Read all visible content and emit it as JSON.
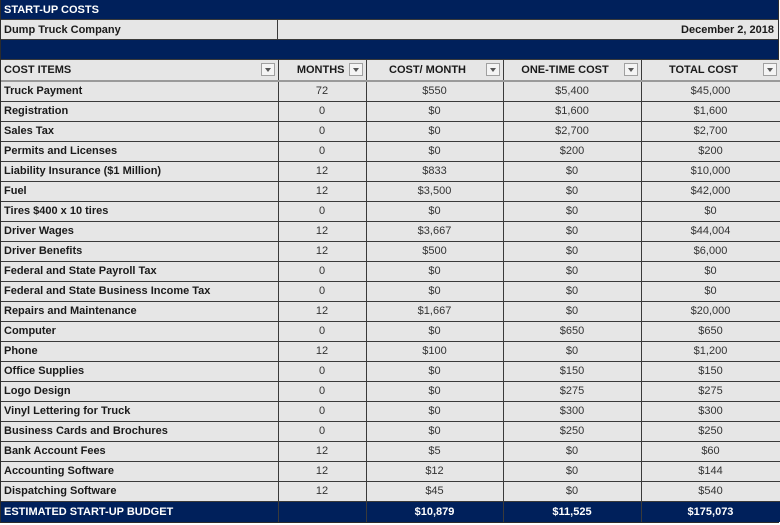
{
  "title": "START-UP COSTS",
  "company": "Dump Truck Company",
  "date": "December 2, 2018",
  "colors": {
    "header_band": "#00205b",
    "cell_bg": "#e6e6e6"
  },
  "columns": [
    {
      "label": "COST ITEMS",
      "filter_icon": "dropdown-filter-icon"
    },
    {
      "label": "MONTHS",
      "filter_icon": "dropdown-filter-icon"
    },
    {
      "label": "COST/ MONTH",
      "filter_icon": "dropdown-filter-icon"
    },
    {
      "label": "ONE-TIME COST",
      "filter_icon": "dropdown-filter-icon"
    },
    {
      "label": "TOTAL COST",
      "filter_icon": "dropdown-filter-icon"
    }
  ],
  "rows": [
    {
      "item": "Truck Payment",
      "months": "72",
      "cost_month": "$550",
      "one_time": "$5,400",
      "total": "$45,000"
    },
    {
      "item": "Registration",
      "months": "0",
      "cost_month": "$0",
      "one_time": "$1,600",
      "total": "$1,600"
    },
    {
      "item": "Sales Tax",
      "months": "0",
      "cost_month": "$0",
      "one_time": "$2,700",
      "total": "$2,700"
    },
    {
      "item": "Permits and Licenses",
      "months": "0",
      "cost_month": "$0",
      "one_time": "$200",
      "total": "$200"
    },
    {
      "item": "Liability Insurance ($1 Million)",
      "months": "12",
      "cost_month": "$833",
      "one_time": "$0",
      "total": "$10,000"
    },
    {
      "item": "Fuel",
      "months": "12",
      "cost_month": "$3,500",
      "one_time": "$0",
      "total": "$42,000"
    },
    {
      "item": "Tires $400 x 10 tires",
      "months": "0",
      "cost_month": "$0",
      "one_time": "$0",
      "total": "$0"
    },
    {
      "item": "Driver Wages",
      "months": "12",
      "cost_month": "$3,667",
      "one_time": "$0",
      "total": "$44,004"
    },
    {
      "item": "Driver Benefits",
      "months": "12",
      "cost_month": "$500",
      "one_time": "$0",
      "total": "$6,000"
    },
    {
      "item": "Federal and State Payroll Tax",
      "months": "0",
      "cost_month": "$0",
      "one_time": "$0",
      "total": "$0"
    },
    {
      "item": "Federal and State Business Income Tax",
      "months": "0",
      "cost_month": "$0",
      "one_time": "$0",
      "total": "$0"
    },
    {
      "item": "Repairs and Maintenance",
      "months": "12",
      "cost_month": "$1,667",
      "one_time": "$0",
      "total": "$20,000"
    },
    {
      "item": "Computer",
      "months": "0",
      "cost_month": "$0",
      "one_time": "$650",
      "total": "$650"
    },
    {
      "item": "Phone",
      "months": "12",
      "cost_month": "$100",
      "one_time": "$0",
      "total": "$1,200"
    },
    {
      "item": "Office Supplies",
      "months": "0",
      "cost_month": "$0",
      "one_time": "$150",
      "total": "$150"
    },
    {
      "item": "Logo Design",
      "months": "0",
      "cost_month": "$0",
      "one_time": "$275",
      "total": "$275"
    },
    {
      "item": "Vinyl Lettering for Truck",
      "months": "0",
      "cost_month": "$0",
      "one_time": "$300",
      "total": "$300"
    },
    {
      "item": "Business Cards and Brochures",
      "months": "0",
      "cost_month": "$0",
      "one_time": "$250",
      "total": "$250"
    },
    {
      "item": "Bank Account Fees",
      "months": "12",
      "cost_month": "$5",
      "one_time": "$0",
      "total": "$60"
    },
    {
      "item": "Accounting Software",
      "months": "12",
      "cost_month": "$12",
      "one_time": "$0",
      "total": "$144"
    },
    {
      "item": "Dispatching Software",
      "months": "12",
      "cost_month": "$45",
      "one_time": "$0",
      "total": "$540"
    }
  ],
  "totals": {
    "label": "ESTIMATED START-UP BUDGET",
    "months": "",
    "cost_month": "$10,879",
    "one_time": "$11,525",
    "total": "$175,073"
  }
}
